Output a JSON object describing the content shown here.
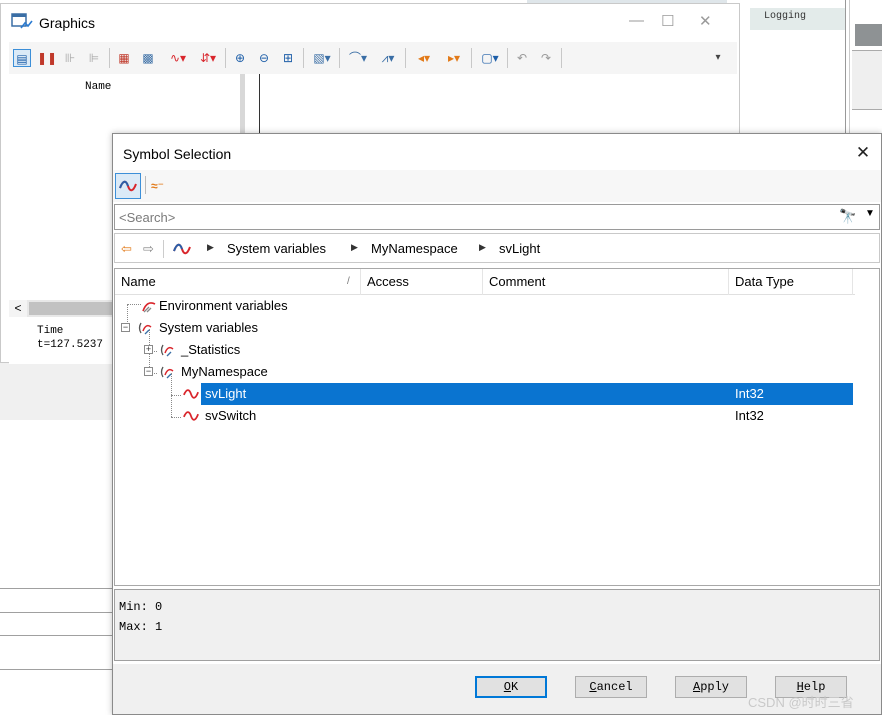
{
  "background": {
    "logging_tab_label": "Logging",
    "logging_panel_label": "Logging"
  },
  "graphics_window": {
    "title": "Graphics",
    "minimize_icon": "—",
    "maximize_icon": "☐",
    "close_icon": "✕",
    "name_column": "Name",
    "scroll_left_icon": "<",
    "time_label": "Time",
    "time_value": "t=127.5237"
  },
  "dialog": {
    "title": "Symbol Selection",
    "close_icon": "✕",
    "search": {
      "placeholder": "<Search>"
    },
    "breadcrumb": [
      "System variables",
      "MyNamespace",
      "svLight"
    ],
    "columns": [
      "Name",
      "Access",
      "Comment",
      "Data Type"
    ],
    "sort_indicator": "/",
    "tree": [
      {
        "label": "Environment variables",
        "data_type": "",
        "level": 0,
        "expander": "",
        "selected": false
      },
      {
        "label": "System variables",
        "data_type": "",
        "level": 0,
        "expander": "−",
        "selected": false
      },
      {
        "label": "_Statistics",
        "data_type": "",
        "level": 1,
        "expander": "+",
        "selected": false
      },
      {
        "label": "MyNamespace",
        "data_type": "",
        "level": 1,
        "expander": "−",
        "selected": false
      },
      {
        "label": "svLight",
        "data_type": "Int32",
        "level": 2,
        "expander": "",
        "selected": true
      },
      {
        "label": "svSwitch",
        "data_type": "Int32",
        "level": 2,
        "expander": "",
        "selected": false
      }
    ],
    "info": {
      "min": "Min: 0",
      "max": "Max: 1"
    },
    "buttons": {
      "ok": {
        "hot": "O",
        "rest": "K"
      },
      "cancel": {
        "hot": "C",
        "rest": "ancel"
      },
      "apply": {
        "hot": "A",
        "rest": "pply"
      },
      "help": {
        "hot": "H",
        "rest": "elp"
      }
    }
  },
  "watermark": "CSDN @时时三省",
  "colors": {
    "selection": "#0a74d0",
    "signal_icon": "#d9262c",
    "accent_orange": "#e27a19"
  }
}
